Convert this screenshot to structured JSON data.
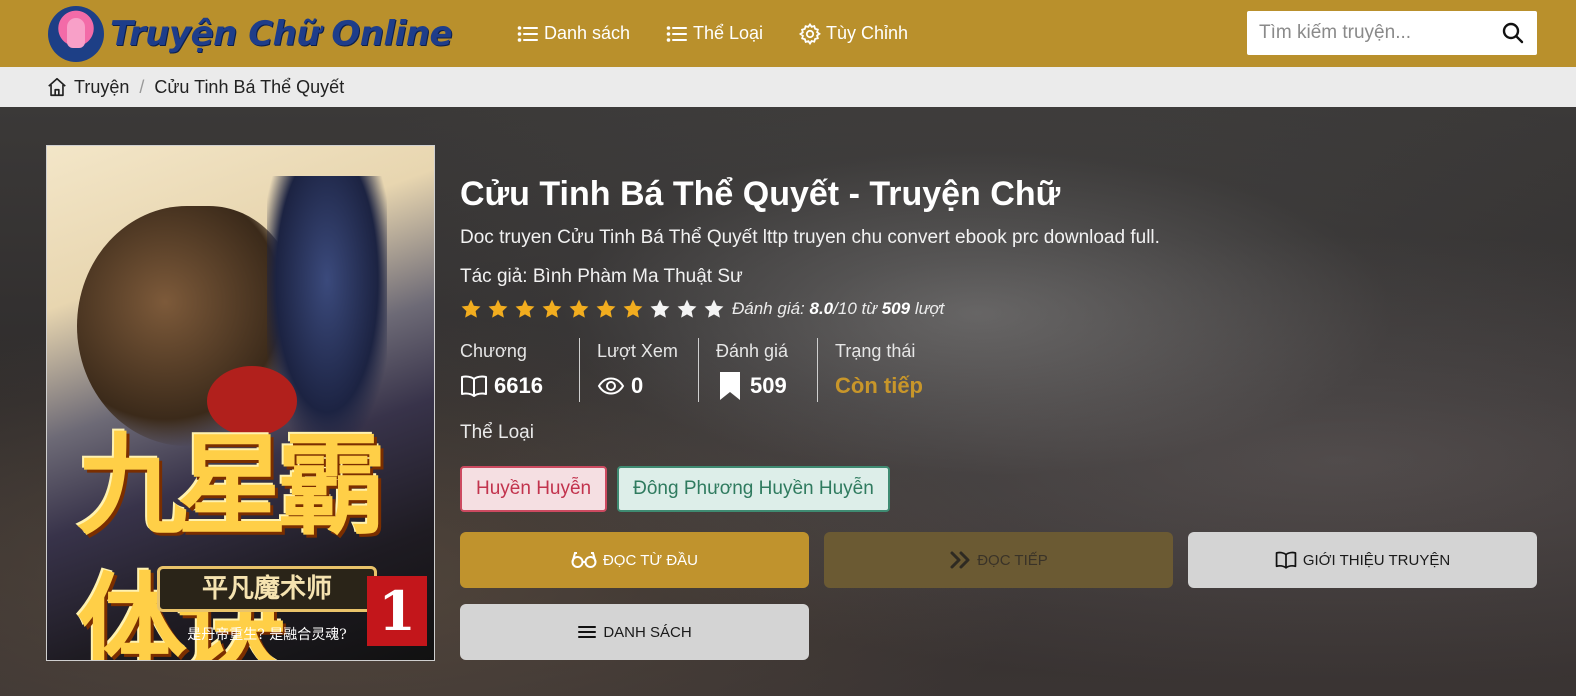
{
  "header": {
    "logo_text": "Truyện Chữ Online",
    "nav": [
      {
        "label": "Danh sách",
        "icon": "list-icon"
      },
      {
        "label": "Thể Loại",
        "icon": "list-icon"
      },
      {
        "label": "Tùy Chỉnh",
        "icon": "gear-icon"
      }
    ],
    "search": {
      "placeholder": "Tìm kiếm truyện...",
      "value": "",
      "icon": "search-icon"
    }
  },
  "breadcrumb": {
    "home": "Truyện",
    "current": "Cửu Tinh Bá Thể Quyết"
  },
  "book": {
    "cover": {
      "title_art": "九星霸体诀",
      "author_band": "平凡魔术师",
      "volume": "1",
      "slogan": "是丹帝重生? 是融合灵魂?"
    },
    "title": "Cửu Tinh Bá Thể Quyết - Truyện Chữ",
    "description": "Doc truyen Cửu Tinh Bá Thể Quyết lttp truyen chu convert ebook prc download full.",
    "author": "Tác giả: Bình Phàm Ma Thuật Sư",
    "rating": {
      "stars_filled": 7,
      "stars_total": 10,
      "prefix": "Đánh giá: ",
      "score": "8.0",
      "mid": "/10 từ ",
      "count": "509",
      "suffix": " lượt"
    },
    "stats": [
      {
        "label": "Chương",
        "value": "6616",
        "icon": "book-open-icon"
      },
      {
        "label": "Lượt Xem",
        "value": "0",
        "icon": "eye-icon"
      },
      {
        "label": "Đánh giá",
        "value": "509",
        "icon": "bookmark-icon"
      },
      {
        "label": "Trạng thái",
        "value": "Còn tiếp"
      }
    ],
    "genre_label": "Thể Loại",
    "genres": [
      "Huyền Huyễn",
      "Đông Phương Huyền Huyễn"
    ],
    "actions": {
      "read_first": "ĐỌC TỪ ĐẦU",
      "read_next": "ĐỌC TIẾP",
      "intro": "GIỚI THIỆU TRUYỆN",
      "list": "DANH SÁCH"
    }
  },
  "colors": {
    "header_bg": "#b9902c",
    "accent": "#c0932d",
    "status": "#c8962a",
    "tag_red": "#c2334d",
    "tag_green": "#2f7b5f"
  }
}
